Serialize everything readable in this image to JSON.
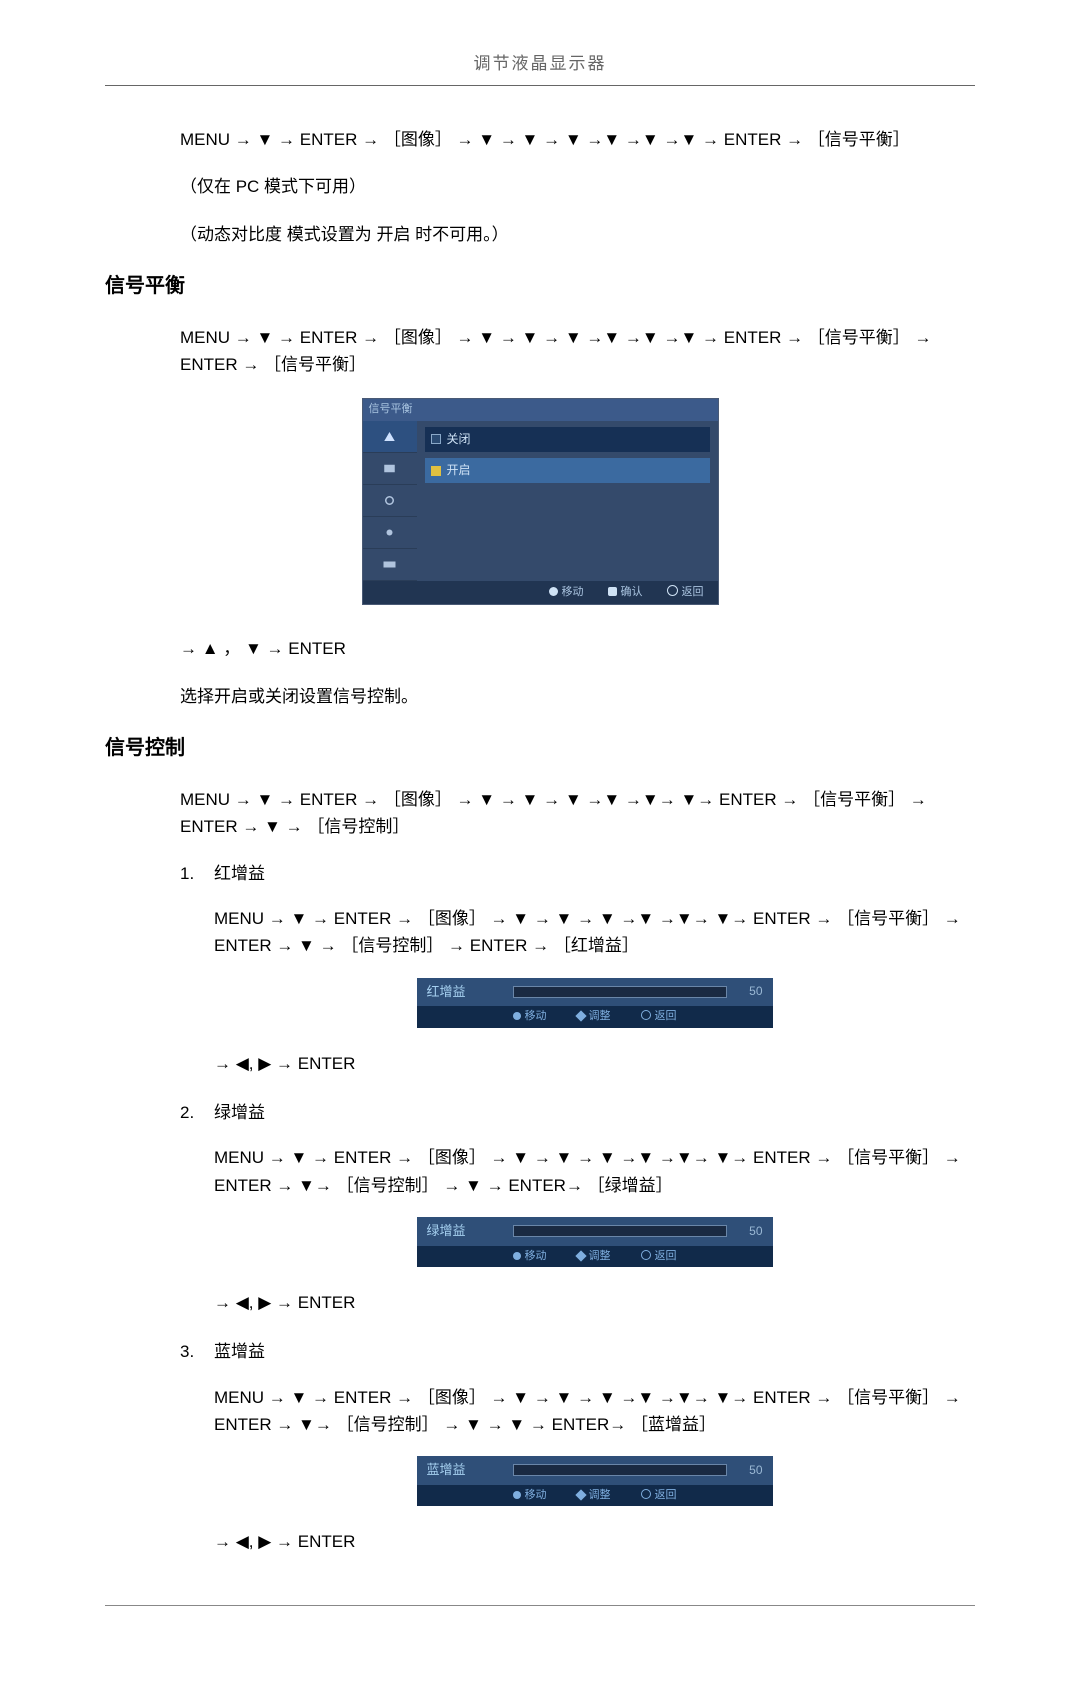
{
  "header": {
    "title": "调节液晶显示器"
  },
  "intro": {
    "nav": "MENU → ▼ → ENTER → ［图像］ → ▼ → ▼ → ▼ →▼ →▼ →▼ → ENTER → ［信号平衡］",
    "pcNote": "（仅在 PC 模式下可用）",
    "dynNote": "（动态对比度 模式设置为 开启 时不可用。）"
  },
  "sec1": {
    "title": "信号平衡",
    "nav": "MENU → ▼ → ENTER → ［图像］ → ▼ → ▼ → ▼ →▼ →▼ →▼ → ENTER → ［信号平衡］ → ENTER → ［信号平衡］",
    "menuTitle": "信号平衡",
    "optOff": "关闭",
    "optOn": "开启",
    "footMove": "移动",
    "footEnter": "确认",
    "footReturn": "返回",
    "adjust": "→ ▲ ， ▼ → ENTER",
    "desc": "选择开启或关闭设置信号控制。"
  },
  "sec2": {
    "title": "信号控制",
    "nav": "MENU → ▼ → ENTER → ［图像］ → ▼ → ▼ → ▼ →▼ →▼→ ▼→ ENTER → ［信号平衡］ → ENTER → ▼ → ［信号控制］",
    "sliderFoot": {
      "move": "移动",
      "adjust": "调整",
      "return": "返回"
    },
    "items": [
      {
        "num": "1.",
        "name": "红增益",
        "nav": "MENU → ▼ → ENTER → ［图像］ → ▼ → ▼ → ▼ →▼ →▼→ ▼→ ENTER → ［信号平衡］ → ENTER → ▼ → ［信号控制］ → ENTER → ［红增益］",
        "label": "红增益",
        "value": "50",
        "adjust": "→ ◀, ▶ → ENTER"
      },
      {
        "num": "2.",
        "name": "绿增益",
        "nav": "MENU → ▼ → ENTER → ［图像］ → ▼ → ▼ → ▼ →▼ →▼→ ▼→ ENTER → ［信号平衡］ → ENTER → ▼→ ［信号控制］ → ▼ → ENTER→ ［绿增益］",
        "label": "绿增益",
        "value": "50",
        "adjust": "→ ◀, ▶ → ENTER"
      },
      {
        "num": "3.",
        "name": "蓝增益",
        "nav": "MENU → ▼ → ENTER → ［图像］ → ▼ → ▼ → ▼ →▼ →▼→ ▼→ ENTER → ［信号平衡］ → ENTER → ▼→ ［信号控制］ → ▼ → ▼ → ENTER→ ［蓝增益］",
        "label": "蓝增益",
        "value": "50",
        "adjust": "→ ◀, ▶ → ENTER"
      }
    ]
  }
}
